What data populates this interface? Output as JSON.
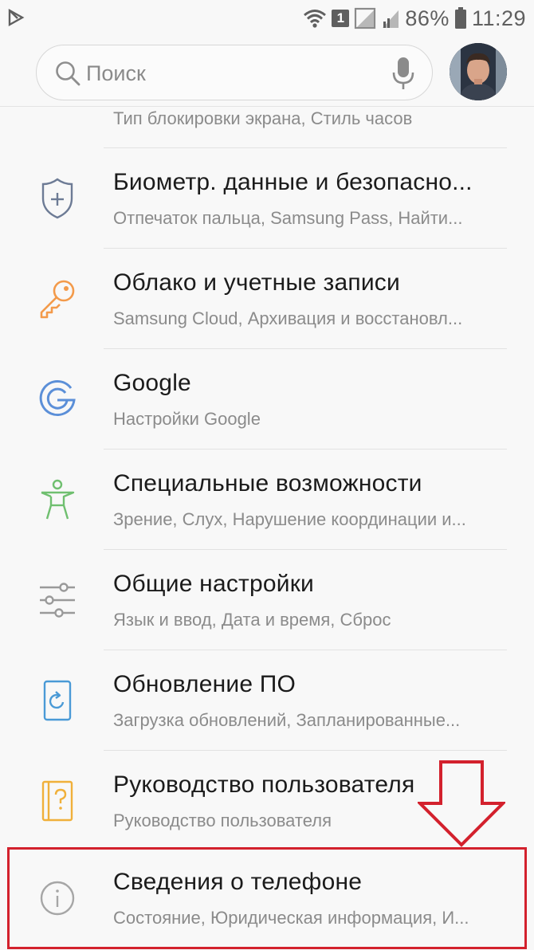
{
  "status_bar": {
    "sim_slot": "1",
    "battery": "86%",
    "time": "11:29"
  },
  "search": {
    "placeholder": "Поиск"
  },
  "settings": [
    {
      "title": "",
      "subtitle": "Тип блокировки экрана, Стиль часов",
      "icon": "lock-screen-icon",
      "color": "#8a7ed8"
    },
    {
      "title": "Биометр. данные и безопасно...",
      "subtitle": "Отпечаток пальца, Samsung Pass, Найти...",
      "icon": "shield-icon",
      "color": "#6d7b95"
    },
    {
      "title": "Облако и учетные записи",
      "subtitle": "Samsung Cloud, Архивация и восстановл...",
      "icon": "key-icon",
      "color": "#f39a4a"
    },
    {
      "title": "Google",
      "subtitle": "Настройки Google",
      "icon": "google-icon",
      "color": "#5b8fd8"
    },
    {
      "title": "Специальные возможности",
      "subtitle": "Зрение, Слух, Нарушение координации и...",
      "icon": "accessibility-icon",
      "color": "#6fbf6f"
    },
    {
      "title": "Общие настройки",
      "subtitle": "Язык и ввод, Дата и время, Сброс",
      "icon": "sliders-icon",
      "color": "#9a9a9a"
    },
    {
      "title": "Обновление ПО",
      "subtitle": "Загрузка обновлений, Запланированные...",
      "icon": "software-update-icon",
      "color": "#4a9ad6"
    },
    {
      "title": "Руководство пользователя",
      "subtitle": "Руководство пользователя",
      "icon": "user-manual-icon",
      "color": "#f0b03a"
    },
    {
      "title": "Сведения о телефоне",
      "subtitle": "Состояние, Юридическая информация, И...",
      "icon": "info-icon",
      "color": "#a6a6a6"
    }
  ],
  "annotation": {
    "color": "#d3212d"
  }
}
